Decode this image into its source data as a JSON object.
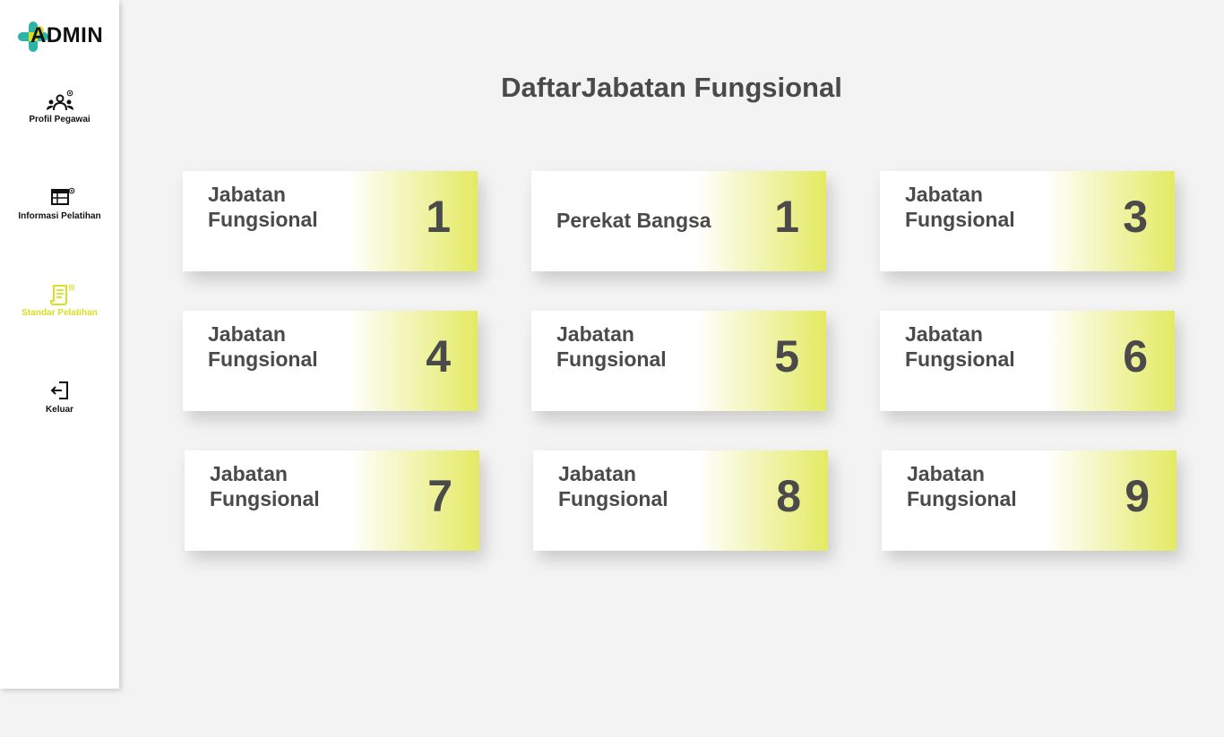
{
  "sidebar": {
    "logo_text": "ADMIN",
    "items": [
      {
        "label": "Profil Pegawai",
        "icon": "users-gear-icon",
        "active": false
      },
      {
        "label": "Informasi Pelatihan",
        "icon": "calendar-gear-icon",
        "active": false
      },
      {
        "label": "Standar Pelatihan",
        "icon": "document-gear-icon",
        "active": true
      },
      {
        "label": "Keluar",
        "icon": "logout-icon",
        "active": false
      }
    ]
  },
  "main": {
    "title": "DaftarJabatan Fungsional",
    "cards": [
      {
        "label": "Jabatan Fungsional",
        "number": "1"
      },
      {
        "label": "Perekat Bangsa",
        "number": "1"
      },
      {
        "label": "Jabatan Fungsional",
        "number": "3"
      },
      {
        "label": "Jabatan Fungsional",
        "number": "4"
      },
      {
        "label": "Jabatan Fungsional",
        "number": "5"
      },
      {
        "label": "Jabatan Fungsional",
        "number": "6"
      },
      {
        "label": "Jabatan Fungsional",
        "number": "7"
      },
      {
        "label": "Jabatan Fungsional",
        "number": "8"
      },
      {
        "label": "Jabatan Fungsional",
        "number": "9"
      }
    ]
  },
  "colors": {
    "accent": "#d9e021",
    "card_gradient_end": "#e4ea63",
    "text_dark": "#4a4a4a",
    "background": "#f3f3f3",
    "logo_teal": "#2bb5a6"
  }
}
